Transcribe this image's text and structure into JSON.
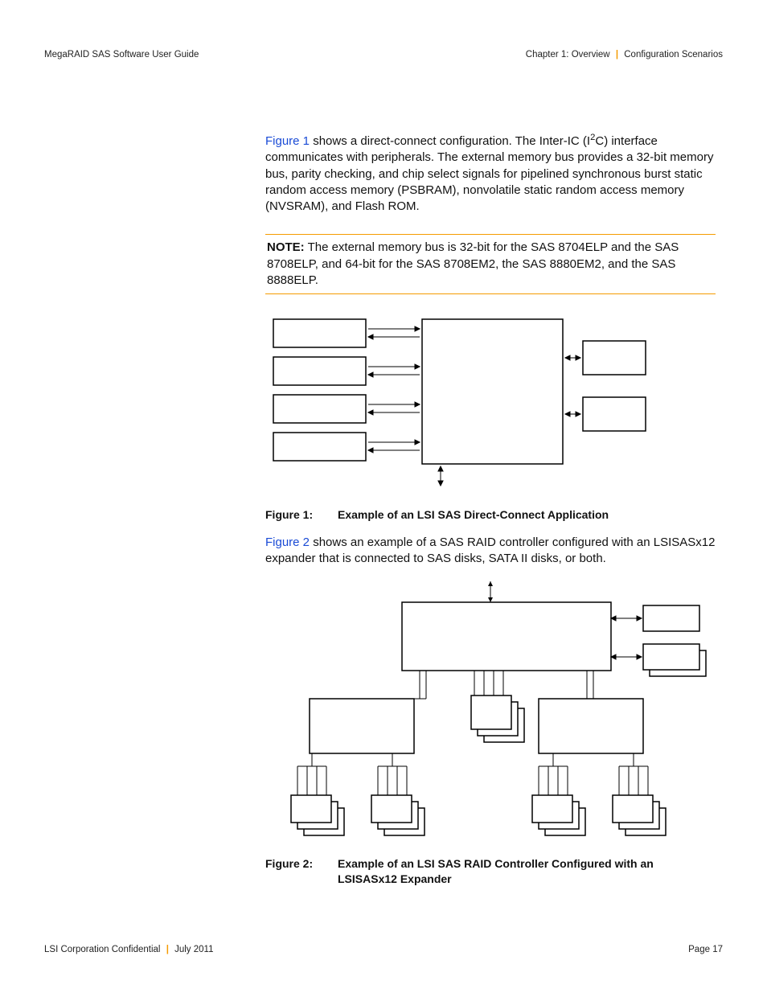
{
  "header": {
    "left": "MegaRAID SAS Software User Guide",
    "right_chapter": "Chapter 1: Overview",
    "right_section": "Configuration Scenarios"
  },
  "para1": {
    "link": "Figure 1",
    "rest": " shows a direct-connect configuration. The Inter-IC (I",
    "sup": "2",
    "after_sup": "C) interface communicates with peripherals. The external memory bus provides a 32-bit memory bus, parity checking, and chip select signals for pipelined synchronous burst static random access memory (PSBRAM), nonvolatile static random access memory (NVSRAM), and Flash ROM."
  },
  "note": {
    "label": "NOTE:",
    "text": " The external memory bus is 32-bit for the SAS 8704ELP and the SAS 8708ELP, and 64-bit for the SAS 8708EM2, the SAS 8880EM2, and the SAS 8888ELP."
  },
  "fig1": {
    "label": "Figure 1:",
    "title": "Example of an LSI SAS Direct-Connect Application"
  },
  "para2": {
    "link": "Figure 2",
    "rest": " shows an example of a SAS RAID controller configured with an LSISASx12 expander that is connected to SAS disks, SATA II disks, or both."
  },
  "fig2": {
    "label": "Figure 2:",
    "title": "Example of an LSI SAS RAID Controller Configured with an LSISASx12 Expander"
  },
  "footer": {
    "left_confidential": "LSI Corporation Confidential",
    "left_date": "July 2011",
    "right": "Page 17"
  }
}
